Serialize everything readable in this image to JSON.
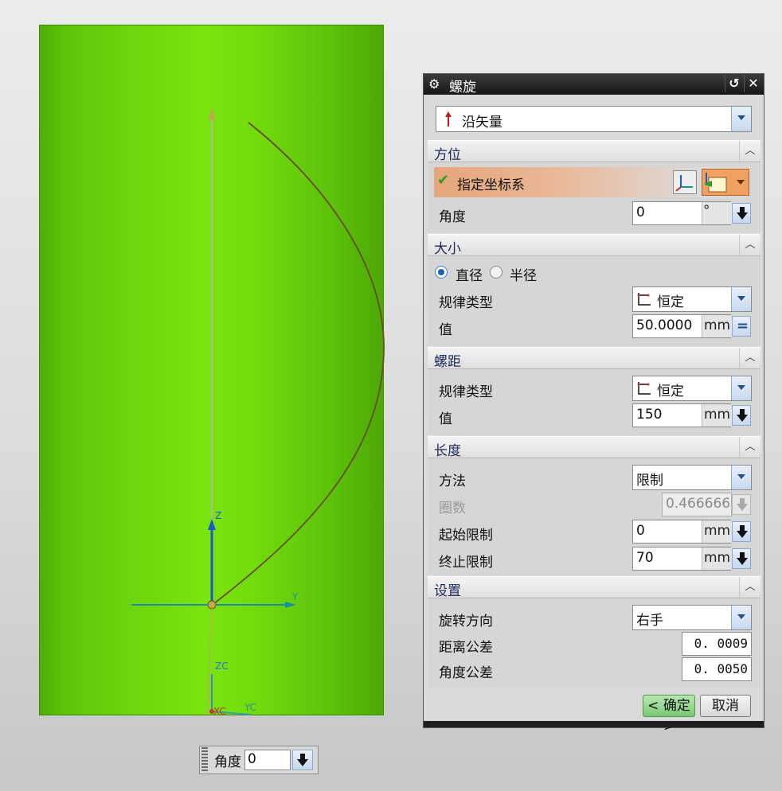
{
  "viewport": {
    "axis_labels": {
      "z": "Z",
      "y": "Y",
      "zc": "ZC",
      "xc": "XC",
      "yc": "YC"
    },
    "colors": {
      "part": "#6fd80c",
      "helix": "#6b4a2a",
      "z_axis": "#1b58c8",
      "y_axis": "#1b8fa0"
    }
  },
  "float_box": {
    "label": "角度",
    "value": "0"
  },
  "dialog": {
    "title": "螺旋",
    "reset_icon": "reset-icon",
    "close_icon": "close-icon",
    "type_combo": {
      "icon": "arrow-up-icon",
      "value": "沿矢量"
    },
    "orientation": {
      "header": "方位",
      "specify_csys": "指定坐标系",
      "angle_label": "角度",
      "angle_value": "0",
      "angle_unit": "°"
    },
    "size": {
      "header": "大小",
      "radio_diameter": "直径",
      "radio_radius": "半径",
      "selected": "直径",
      "law_type_label": "规律类型",
      "law_type_value": "恒定",
      "value_label": "值",
      "value": "50.0000",
      "unit": "mm"
    },
    "pitch": {
      "header": "螺距",
      "law_type_label": "规律类型",
      "law_type_value": "恒定",
      "value_label": "值",
      "value": "150",
      "unit": "mm"
    },
    "length": {
      "header": "长度",
      "method_label": "方法",
      "method_value": "限制",
      "turns_label": "圈数",
      "turns_value": "0.466666",
      "start_label": "起始限制",
      "start_value": "0",
      "end_label": "终止限制",
      "end_value": "70",
      "unit": "mm"
    },
    "settings": {
      "header": "设置",
      "direction_label": "旋转方向",
      "direction_value": "右手",
      "dist_tol_label": "距离公差",
      "dist_tol_value": "0. 0009",
      "angle_tol_label": "角度公差",
      "angle_tol_value": "0. 0050"
    },
    "ok_button": "< 确定 >",
    "cancel_button": "取消",
    "colors": {
      "ok_green": "#8fd08a",
      "title_bar": "#1f1f1f",
      "section_title": "#1d2a5c",
      "csys_highlight": "#e8a87c"
    }
  }
}
